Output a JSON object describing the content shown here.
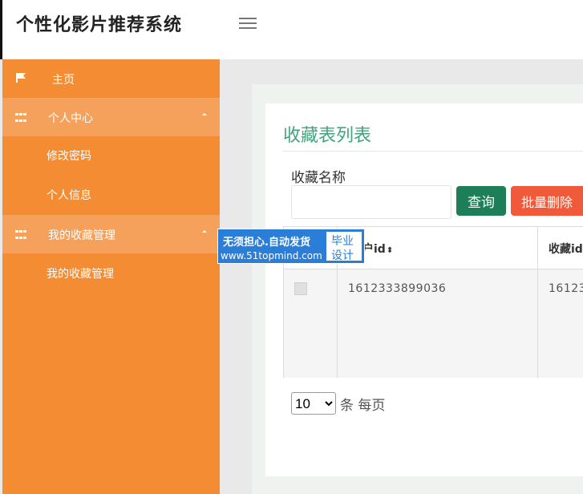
{
  "header": {
    "title": "个性化影片推荐系统"
  },
  "sidebar": {
    "items": [
      {
        "label": "主页",
        "icon": "flag-icon"
      },
      {
        "label": "个人中心",
        "icon": "grid-icon"
      },
      {
        "label": "修改密码"
      },
      {
        "label": "个人信息"
      },
      {
        "label": "我的收藏管理",
        "icon": "grid-icon"
      },
      {
        "label": "我的收藏管理"
      }
    ]
  },
  "ad": {
    "line1": "无须担心.自动发货",
    "line2": "www.51topmind.com",
    "badge_line1": "毕业",
    "badge_line2": "设计"
  },
  "main": {
    "title": "收藏表列表",
    "search_label": "收藏名称",
    "search_value": "",
    "query_button": "查询",
    "delete_button": "批量删除",
    "columns": [
      "户id",
      "收藏id"
    ],
    "rows": [
      {
        "col1": "1612333899036",
        "col2": "16123"
      }
    ],
    "page_size": "10",
    "page_size_suffix": "条 每页"
  },
  "colors": {
    "sidebar": "#f48c33",
    "sidebar_group": "#f5a05b",
    "accent_green": "#3fa57d",
    "query_button": "#1d7f57",
    "delete_button": "#f05a3a"
  }
}
